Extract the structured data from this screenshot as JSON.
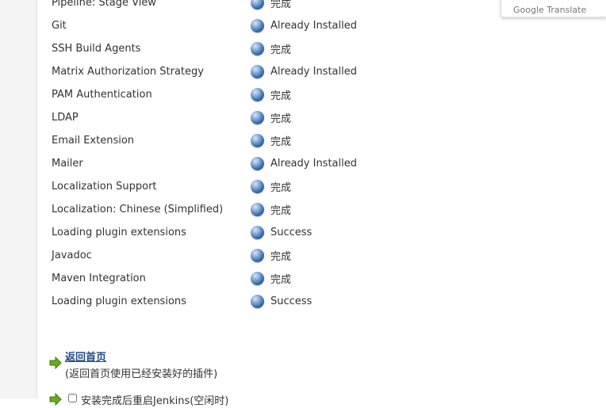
{
  "plugins": [
    {
      "name": "Pipeline: Stage View",
      "status": "完成"
    },
    {
      "name": "Git",
      "status": "Already Installed"
    },
    {
      "name": "SSH Build Agents",
      "status": "完成"
    },
    {
      "name": "Matrix Authorization Strategy",
      "status": "Already Installed"
    },
    {
      "name": "PAM Authentication",
      "status": "完成"
    },
    {
      "name": "LDAP",
      "status": "完成"
    },
    {
      "name": "Email Extension",
      "status": "完成"
    },
    {
      "name": "Mailer",
      "status": "Already Installed"
    },
    {
      "name": "Localization Support",
      "status": "完成"
    },
    {
      "name": "Localization: Chinese (Simplified)",
      "status": "完成"
    },
    {
      "name": "Loading plugin extensions",
      "status": "Success"
    },
    {
      "name": "Javadoc",
      "status": "完成"
    },
    {
      "name": "Maven Integration",
      "status": "完成"
    },
    {
      "name": "Loading plugin extensions",
      "status": "Success"
    }
  ],
  "status_icon": "blue-ball-icon",
  "translate_popup": {
    "label": "Google Translate"
  },
  "home": {
    "link_label": "返回首页",
    "description": "(返回首页使用已经安装好的插件)"
  },
  "restart": {
    "label": "安装完成后重启Jenkins(空闲时)"
  },
  "colors": {
    "link": "#204a87",
    "arrow": "#6aaa1e",
    "status_ball": "#3b6fb0"
  }
}
